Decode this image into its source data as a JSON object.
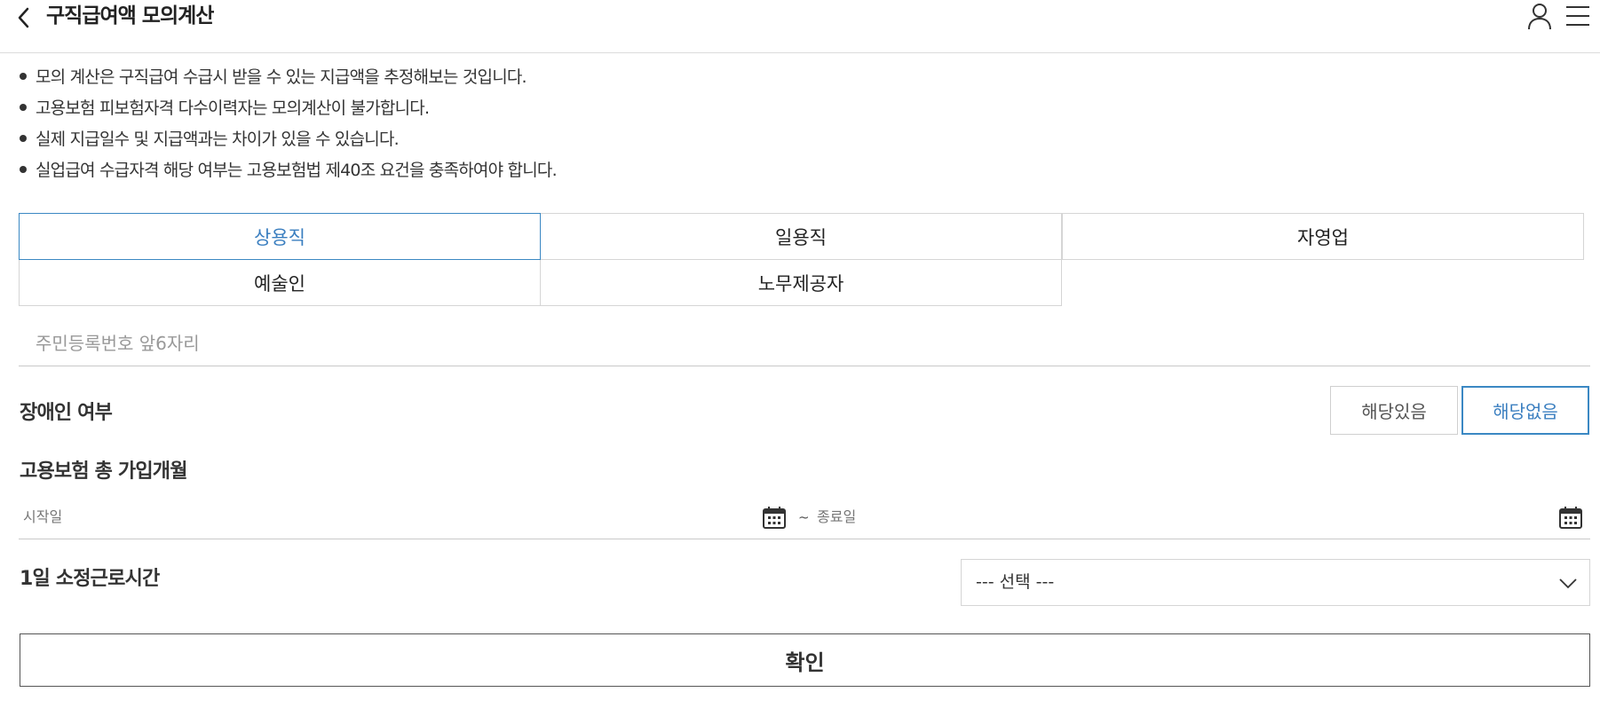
{
  "header": {
    "title": "구직급여액 모의계산",
    "back_icon": "chevron-left-icon",
    "user_icon": "user-icon",
    "menu_icon": "hamburger-menu-icon"
  },
  "notices": [
    "모의 계산은 구직급여 수급시 받을 수 있는 지급액을 추정해보는 것입니다.",
    "고용보험 피보험자격 다수이력자는 모의계산이 불가합니다.",
    "실제 지급일수 및 지급액과는 차이가 있을 수 있습니다.",
    "실업급여 수급자격 해당 여부는 고용보험법 제40조 요건을 충족하여야 합니다."
  ],
  "tabs": {
    "items": [
      {
        "label": "상용직",
        "active": true
      },
      {
        "label": "일용직",
        "active": false
      },
      {
        "label": "자영업",
        "active": false
      },
      {
        "label": "예술인",
        "active": false
      },
      {
        "label": "노무제공자",
        "active": false
      }
    ]
  },
  "resident": {
    "placeholder": "주민등록번호 앞6자리",
    "value": ""
  },
  "disability": {
    "label": "장애인 여부",
    "yes_label": "해당있음",
    "no_label": "해당없음",
    "selected": "해당없음"
  },
  "insurance": {
    "label": "고용보험 총 가입개월",
    "start_placeholder": "시작일",
    "separator": "~",
    "end_placeholder": "종료일",
    "calendar_icon": "calendar-icon"
  },
  "hours": {
    "label": "1일 소정근로시간",
    "selected": "--- 선택 ---",
    "dropdown_icon": "chevron-down-icon"
  },
  "confirm": {
    "label": "확인"
  },
  "colors": {
    "accent": "#3b88c3",
    "accent_text": "#3b7fc0",
    "border": "#d5d5d5",
    "text": "#222222"
  }
}
